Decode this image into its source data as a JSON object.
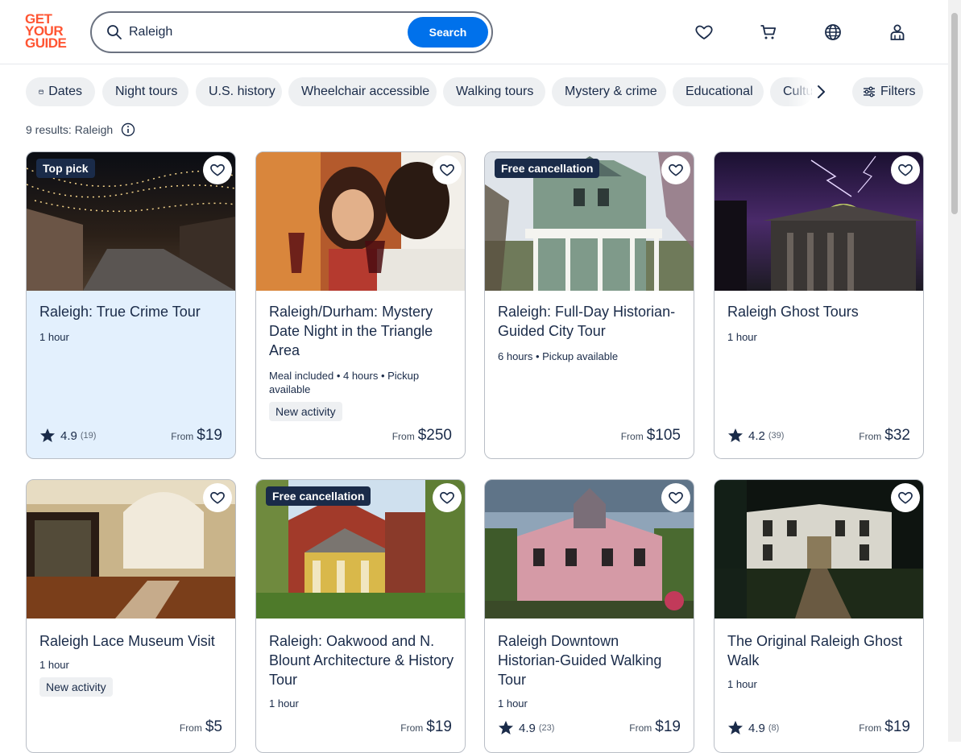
{
  "logo": {
    "lines": [
      "GET",
      "YOUR",
      "GUIDE"
    ]
  },
  "search": {
    "value": "Raleigh",
    "button_label": "Search"
  },
  "header_icons": [
    "heart-icon",
    "cart-icon",
    "globe-icon",
    "account-icon"
  ],
  "chips": [
    "Dates",
    "Night tours",
    "U.S. history",
    "Wheelchair accessible",
    "Walking tours",
    "Mystery & crime",
    "Educational",
    "Cultu"
  ],
  "filters_label": "Filters",
  "results_text": "9 results: Raleigh",
  "colors": {
    "accent": "#0071eb",
    "brand": "#ff5533",
    "text": "#1a2b49",
    "badge": "#1a2b49",
    "highlight": "#e3f0fd"
  },
  "cards": [
    {
      "title": "Raleigh: True Crime Tour",
      "badge": "Top pick",
      "meta": "1 hour",
      "new_tag": "",
      "rating": "4.9",
      "reviews": "(19)",
      "from": "From",
      "price": "$19"
    },
    {
      "title": "Raleigh/Durham: Mystery Date Night in the Triangle Area",
      "badge": "",
      "meta": "Meal included • 4 hours • Pickup available",
      "new_tag": "New activity",
      "rating": "",
      "reviews": "",
      "from": "From",
      "price": "$250"
    },
    {
      "title": "Raleigh: Full-Day Historian-Guided City Tour",
      "badge": "Free cancellation",
      "meta": "6 hours • Pickup available",
      "new_tag": "",
      "rating": "",
      "reviews": "",
      "from": "From",
      "price": "$105"
    },
    {
      "title": "Raleigh Ghost Tours",
      "badge": "",
      "meta": "1 hour",
      "new_tag": "",
      "rating": "4.2",
      "reviews": "(39)",
      "from": "From",
      "price": "$32"
    },
    {
      "title": "Raleigh Lace Museum Visit",
      "badge": "",
      "meta": "1 hour",
      "new_tag": "New activity",
      "rating": "",
      "reviews": "",
      "from": "From",
      "price": "$5"
    },
    {
      "title": "Raleigh: Oakwood and N. Blount Architecture & History Tour",
      "badge": "Free cancellation",
      "meta": "1 hour",
      "new_tag": "",
      "rating": "",
      "reviews": "",
      "from": "From",
      "price": "$19"
    },
    {
      "title": "Raleigh Downtown Historian-Guided Walking Tour",
      "badge": "",
      "meta": "1 hour",
      "new_tag": "",
      "rating": "4.9",
      "reviews": "(23)",
      "from": "From",
      "price": "$19"
    },
    {
      "title": "The Original Raleigh Ghost Walk",
      "badge": "",
      "meta": "1 hour",
      "new_tag": "",
      "rating": "4.9",
      "reviews": "(8)",
      "from": "From",
      "price": "$19"
    }
  ]
}
